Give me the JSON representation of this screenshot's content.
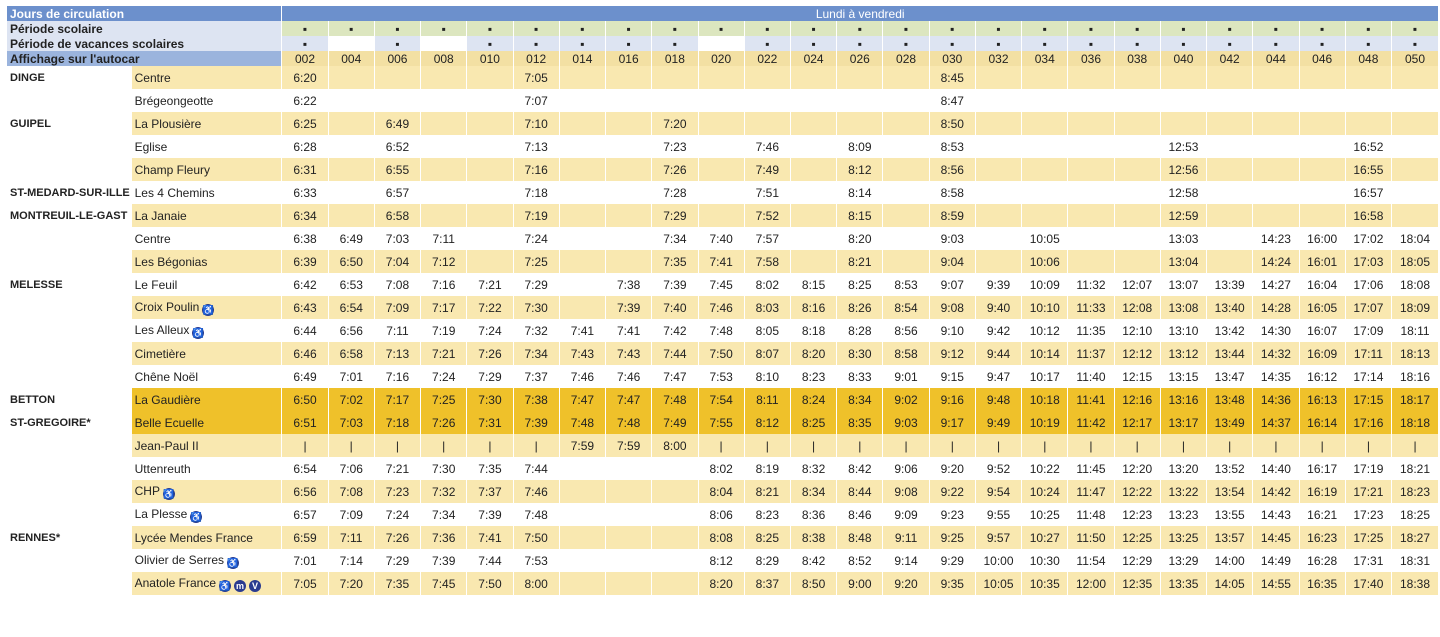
{
  "headers": {
    "jours_label": "Jours de circulation",
    "jours_value": "Lundi à vendredi",
    "periode_scolaire_label": "Période scolaire",
    "periode_vacances_label": "Période de vacances scolaires",
    "affichage_label": "Affichage sur l'autocar",
    "marker": "▪"
  },
  "columns": [
    "002",
    "004",
    "006",
    "008",
    "010",
    "012",
    "014",
    "016",
    "018",
    "020",
    "022",
    "024",
    "026",
    "028",
    "030",
    "032",
    "034",
    "036",
    "038",
    "040",
    "042",
    "044",
    "046",
    "048",
    "050"
  ],
  "periode_scolaire": [
    true,
    true,
    true,
    true,
    true,
    true,
    true,
    true,
    true,
    true,
    true,
    true,
    true,
    true,
    true,
    true,
    true,
    true,
    true,
    true,
    true,
    true,
    true,
    true,
    true
  ],
  "periode_vacances": [
    true,
    false,
    true,
    false,
    true,
    true,
    true,
    true,
    true,
    false,
    true,
    true,
    true,
    true,
    true,
    true,
    true,
    true,
    true,
    true,
    true,
    true,
    true,
    true,
    true
  ],
  "stops": [
    {
      "commune": "DINGE",
      "stop": "Centre",
      "icons": [],
      "shaded": true,
      "highlight": false,
      "times": [
        "6:20",
        "",
        "",
        "",
        "",
        "7:05",
        "",
        "",
        "",
        "",
        "",
        "",
        "",
        "",
        "8:45",
        "",
        "",
        "",
        "",
        "",
        "",
        "",
        "",
        "",
        ""
      ]
    },
    {
      "commune": "",
      "stop": "Brégeongeotte",
      "icons": [],
      "shaded": false,
      "highlight": false,
      "times": [
        "6:22",
        "",
        "",
        "",
        "",
        "7:07",
        "",
        "",
        "",
        "",
        "",
        "",
        "",
        "",
        "8:47",
        "",
        "",
        "",
        "",
        "",
        "",
        "",
        "",
        "",
        ""
      ]
    },
    {
      "commune": "GUIPEL",
      "stop": "La Plousière",
      "icons": [],
      "shaded": true,
      "highlight": false,
      "times": [
        "6:25",
        "",
        "6:49",
        "",
        "",
        "7:10",
        "",
        "",
        "7:20",
        "",
        "",
        "",
        "",
        "",
        "8:50",
        "",
        "",
        "",
        "",
        "",
        "",
        "",
        "",
        "",
        ""
      ]
    },
    {
      "commune": "",
      "stop": "Eglise",
      "icons": [],
      "shaded": false,
      "highlight": false,
      "times": [
        "6:28",
        "",
        "6:52",
        "",
        "",
        "7:13",
        "",
        "",
        "7:23",
        "",
        "7:46",
        "",
        "8:09",
        "",
        "8:53",
        "",
        "",
        "",
        "",
        "12:53",
        "",
        "",
        "",
        "16:52",
        ""
      ]
    },
    {
      "commune": "",
      "stop": "Champ Fleury",
      "icons": [],
      "shaded": true,
      "highlight": false,
      "times": [
        "6:31",
        "",
        "6:55",
        "",
        "",
        "7:16",
        "",
        "",
        "7:26",
        "",
        "7:49",
        "",
        "8:12",
        "",
        "8:56",
        "",
        "",
        "",
        "",
        "12:56",
        "",
        "",
        "",
        "16:55",
        ""
      ]
    },
    {
      "commune": "ST-MEDARD-SUR-ILLE",
      "stop": "Les 4 Chemins",
      "icons": [],
      "shaded": false,
      "highlight": false,
      "times": [
        "6:33",
        "",
        "6:57",
        "",
        "",
        "7:18",
        "",
        "",
        "7:28",
        "",
        "7:51",
        "",
        "8:14",
        "",
        "8:58",
        "",
        "",
        "",
        "",
        "12:58",
        "",
        "",
        "",
        "16:57",
        ""
      ]
    },
    {
      "commune": "MONTREUIL-LE-GAST",
      "stop": "La Janaie",
      "icons": [],
      "shaded": true,
      "highlight": false,
      "times": [
        "6:34",
        "",
        "6:58",
        "",
        "",
        "7:19",
        "",
        "",
        "7:29",
        "",
        "7:52",
        "",
        "8:15",
        "",
        "8:59",
        "",
        "",
        "",
        "",
        "12:59",
        "",
        "",
        "",
        "16:58",
        ""
      ]
    },
    {
      "commune": "",
      "stop": "Centre",
      "icons": [],
      "shaded": false,
      "highlight": false,
      "times": [
        "6:38",
        "6:49",
        "7:03",
        "7:11",
        "",
        "7:24",
        "",
        "",
        "7:34",
        "7:40",
        "7:57",
        "",
        "8:20",
        "",
        "9:03",
        "",
        "10:05",
        "",
        "",
        "13:03",
        "",
        "14:23",
        "16:00",
        "17:02",
        "18:04"
      ]
    },
    {
      "commune": "",
      "stop": "Les Bégonias",
      "icons": [],
      "shaded": true,
      "highlight": false,
      "times": [
        "6:39",
        "6:50",
        "7:04",
        "7:12",
        "",
        "7:25",
        "",
        "",
        "7:35",
        "7:41",
        "7:58",
        "",
        "8:21",
        "",
        "9:04",
        "",
        "10:06",
        "",
        "",
        "13:04",
        "",
        "14:24",
        "16:01",
        "17:03",
        "18:05"
      ]
    },
    {
      "commune": "MELESSE",
      "stop": "Le Feuil",
      "icons": [],
      "shaded": false,
      "highlight": false,
      "times": [
        "6:42",
        "6:53",
        "7:08",
        "7:16",
        "7:21",
        "7:29",
        "",
        "7:38",
        "7:39",
        "7:45",
        "8:02",
        "8:15",
        "8:25",
        "8:53",
        "9:07",
        "9:39",
        "10:09",
        "11:32",
        "12:07",
        "13:07",
        "13:39",
        "14:27",
        "16:04",
        "17:06",
        "18:08"
      ]
    },
    {
      "commune": "",
      "stop": "Croix Poulin",
      "icons": [
        "accessible"
      ],
      "shaded": true,
      "highlight": false,
      "times": [
        "6:43",
        "6:54",
        "7:09",
        "7:17",
        "7:22",
        "7:30",
        "",
        "7:39",
        "7:40",
        "7:46",
        "8:03",
        "8:16",
        "8:26",
        "8:54",
        "9:08",
        "9:40",
        "10:10",
        "11:33",
        "12:08",
        "13:08",
        "13:40",
        "14:28",
        "16:05",
        "17:07",
        "18:09"
      ]
    },
    {
      "commune": "",
      "stop": "Les Alleux",
      "icons": [
        "accessible"
      ],
      "shaded": false,
      "highlight": false,
      "times": [
        "6:44",
        "6:56",
        "7:11",
        "7:19",
        "7:24",
        "7:32",
        "7:41",
        "7:41",
        "7:42",
        "7:48",
        "8:05",
        "8:18",
        "8:28",
        "8:56",
        "9:10",
        "9:42",
        "10:12",
        "11:35",
        "12:10",
        "13:10",
        "13:42",
        "14:30",
        "16:07",
        "17:09",
        "18:11"
      ]
    },
    {
      "commune": "",
      "stop": "Cimetière",
      "icons": [],
      "shaded": true,
      "highlight": false,
      "times": [
        "6:46",
        "6:58",
        "7:13",
        "7:21",
        "7:26",
        "7:34",
        "7:43",
        "7:43",
        "7:44",
        "7:50",
        "8:07",
        "8:20",
        "8:30",
        "8:58",
        "9:12",
        "9:44",
        "10:14",
        "11:37",
        "12:12",
        "13:12",
        "13:44",
        "14:32",
        "16:09",
        "17:11",
        "18:13"
      ]
    },
    {
      "commune": "",
      "stop": "Chêne Noël",
      "icons": [],
      "shaded": false,
      "highlight": false,
      "times": [
        "6:49",
        "7:01",
        "7:16",
        "7:24",
        "7:29",
        "7:37",
        "7:46",
        "7:46",
        "7:47",
        "7:53",
        "8:10",
        "8:23",
        "8:33",
        "9:01",
        "9:15",
        "9:47",
        "10:17",
        "11:40",
        "12:15",
        "13:15",
        "13:47",
        "14:35",
        "16:12",
        "17:14",
        "18:16"
      ]
    },
    {
      "commune": "BETTON",
      "stop": "La Gaudière",
      "icons": [],
      "shaded": false,
      "highlight": true,
      "times": [
        "6:50",
        "7:02",
        "7:17",
        "7:25",
        "7:30",
        "7:38",
        "7:47",
        "7:47",
        "7:48",
        "7:54",
        "8:11",
        "8:24",
        "8:34",
        "9:02",
        "9:16",
        "9:48",
        "10:18",
        "11:41",
        "12:16",
        "13:16",
        "13:48",
        "14:36",
        "16:13",
        "17:15",
        "18:17"
      ]
    },
    {
      "commune": "ST-GREGOIRE*",
      "stop": "Belle Ecuelle",
      "icons": [],
      "shaded": false,
      "highlight": true,
      "times": [
        "6:51",
        "7:03",
        "7:18",
        "7:26",
        "7:31",
        "7:39",
        "7:48",
        "7:48",
        "7:49",
        "7:55",
        "8:12",
        "8:25",
        "8:35",
        "9:03",
        "9:17",
        "9:49",
        "10:19",
        "11:42",
        "12:17",
        "13:17",
        "13:49",
        "14:37",
        "16:14",
        "17:16",
        "18:18"
      ]
    },
    {
      "commune": "",
      "stop": "Jean-Paul II",
      "icons": [],
      "shaded": true,
      "highlight": false,
      "times": [
        "|",
        "|",
        "|",
        "|",
        "|",
        "|",
        "7:59",
        "7:59",
        "8:00",
        "|",
        "|",
        "|",
        "|",
        "|",
        "|",
        "|",
        "|",
        "|",
        "|",
        "|",
        "|",
        "|",
        "|",
        "|",
        "|"
      ]
    },
    {
      "commune": "",
      "stop": "Uttenreuth",
      "icons": [],
      "shaded": false,
      "highlight": false,
      "times": [
        "6:54",
        "7:06",
        "7:21",
        "7:30",
        "7:35",
        "7:44",
        "",
        "",
        "",
        "8:02",
        "8:19",
        "8:32",
        "8:42",
        "9:06",
        "9:20",
        "9:52",
        "10:22",
        "11:45",
        "12:20",
        "13:20",
        "13:52",
        "14:40",
        "16:17",
        "17:19",
        "18:21"
      ]
    },
    {
      "commune": "",
      "stop": "CHP",
      "icons": [
        "accessible"
      ],
      "shaded": true,
      "highlight": false,
      "times": [
        "6:56",
        "7:08",
        "7:23",
        "7:32",
        "7:37",
        "7:46",
        "",
        "",
        "",
        "8:04",
        "8:21",
        "8:34",
        "8:44",
        "9:08",
        "9:22",
        "9:54",
        "10:24",
        "11:47",
        "12:22",
        "13:22",
        "13:54",
        "14:42",
        "16:19",
        "17:21",
        "18:23"
      ]
    },
    {
      "commune": "",
      "stop": "La Plesse",
      "icons": [
        "accessible"
      ],
      "shaded": false,
      "highlight": false,
      "times": [
        "6:57",
        "7:09",
        "7:24",
        "7:34",
        "7:39",
        "7:48",
        "",
        "",
        "",
        "8:06",
        "8:23",
        "8:36",
        "8:46",
        "9:09",
        "9:23",
        "9:55",
        "10:25",
        "11:48",
        "12:23",
        "13:23",
        "13:55",
        "14:43",
        "16:21",
        "17:23",
        "18:25"
      ]
    },
    {
      "commune": "RENNES*",
      "stop": "Lycée Mendes France",
      "icons": [],
      "shaded": true,
      "highlight": false,
      "times": [
        "6:59",
        "7:11",
        "7:26",
        "7:36",
        "7:41",
        "7:50",
        "",
        "",
        "",
        "8:08",
        "8:25",
        "8:38",
        "8:48",
        "9:11",
        "9:25",
        "9:57",
        "10:27",
        "11:50",
        "12:25",
        "13:25",
        "13:57",
        "14:45",
        "16:23",
        "17:25",
        "18:27"
      ]
    },
    {
      "commune": "",
      "stop": "Olivier de Serres",
      "icons": [
        "accessible"
      ],
      "shaded": false,
      "highlight": false,
      "times": [
        "7:01",
        "7:14",
        "7:29",
        "7:39",
        "7:44",
        "7:53",
        "",
        "",
        "",
        "8:12",
        "8:29",
        "8:42",
        "8:52",
        "9:14",
        "9:29",
        "10:00",
        "10:30",
        "11:54",
        "12:29",
        "13:29",
        "14:00",
        "14:49",
        "16:28",
        "17:31",
        "18:31"
      ]
    },
    {
      "commune": "",
      "stop": "Anatole France",
      "icons": [
        "accessible",
        "metro",
        "velo"
      ],
      "shaded": true,
      "highlight": false,
      "times": [
        "7:05",
        "7:20",
        "7:35",
        "7:45",
        "7:50",
        "8:00",
        "",
        "",
        "",
        "8:20",
        "8:37",
        "8:50",
        "9:00",
        "9:20",
        "9:35",
        "10:05",
        "10:35",
        "12:00",
        "12:35",
        "13:35",
        "14:05",
        "14:55",
        "16:35",
        "17:40",
        "18:38"
      ]
    }
  ],
  "icon_glyphs": {
    "accessible": "♿",
    "metro": "m",
    "velo": "V"
  }
}
